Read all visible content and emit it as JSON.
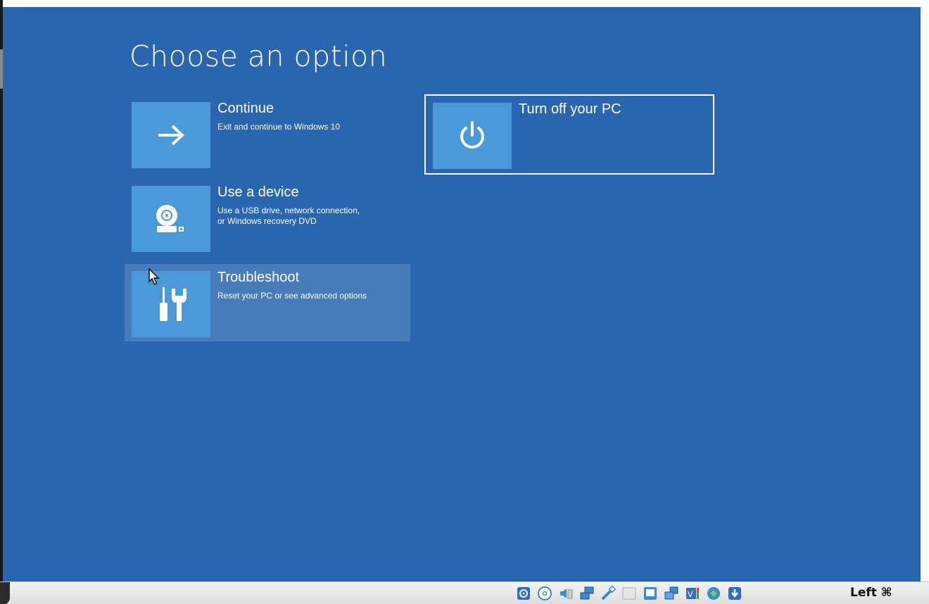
{
  "screen": {
    "title": "Choose an option",
    "background": "#2a66b0",
    "tile_color": "#4a9ad9"
  },
  "options": [
    {
      "title": "Continue",
      "description": "Exit and continue to Windows 10",
      "icon": "arrow-right-icon"
    },
    {
      "title": "Use a device",
      "description": "Use a USB drive, network connection,\nor Windows recovery DVD",
      "icon": "disc-drive-icon"
    },
    {
      "title": "Troubleshoot",
      "description": "Reset your PC or see advanced options",
      "icon": "tools-icon",
      "state": "hovered"
    },
    {
      "title": "Turn off your PC",
      "description": "",
      "icon": "power-icon",
      "state": "focused"
    }
  ],
  "statusbar": {
    "icons": [
      "hard-disk-icon",
      "optical-drive-icon",
      "audio-icon",
      "network-icon",
      "usb-icon",
      "shared-folders-icon",
      "display-icon",
      "video-capture-icon",
      "cpu-icon",
      "recording-icon",
      "mouse-integration-icon"
    ],
    "host_key": "Left ⌘"
  }
}
